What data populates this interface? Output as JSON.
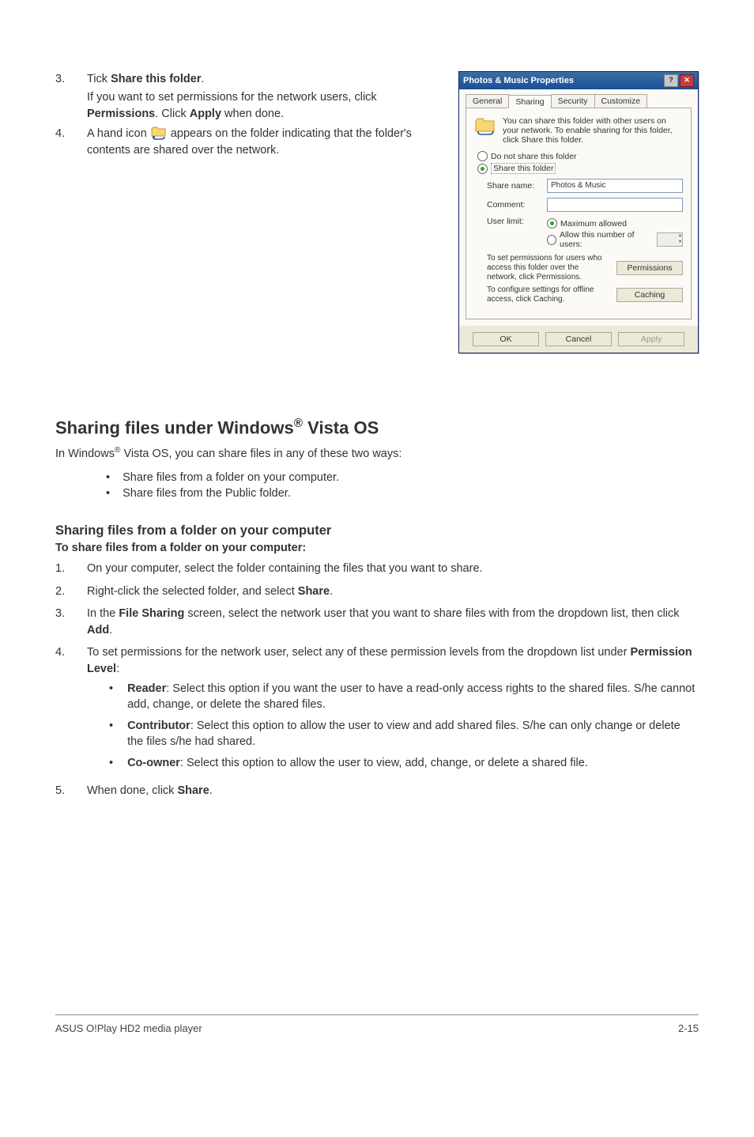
{
  "top": {
    "step3_num": "3.",
    "step3_line1_a": "Tick ",
    "step3_line1_b": "Share this folder",
    "step3_line1_c": ".",
    "step3_sub_a": "If you want to set permissions for the network users, click ",
    "step3_sub_b": "Permissions",
    "step3_sub_c": ". Click ",
    "step3_sub_d": "Apply",
    "step3_sub_e": " when done.",
    "step4_num": "4.",
    "step4_a": "A hand icon ",
    "step4_b": " appears on the folder indicating that the folder's contents are shared over the network."
  },
  "dialog": {
    "title": "Photos & Music Properties",
    "help": "?",
    "close": "✕",
    "tabs": {
      "general": "General",
      "sharing": "Sharing",
      "security": "Security",
      "customize": "Customize"
    },
    "desc": "You can share this folder with other users on your network. To enable sharing for this folder, click Share this folder.",
    "radio_no": "Do not share this folder",
    "radio_yes": "Share this folder",
    "share_name_lbl": "Share name:",
    "share_name_val": "Photos & Music",
    "comment_lbl": "Comment:",
    "userlimit_lbl": "User limit:",
    "ul_max": "Maximum allowed",
    "ul_allow": "Allow this number of users:",
    "perm_txt": "To set permissions for users who access this folder over the network, click Permissions.",
    "perm_btn": "Permissions",
    "cache_txt": "To configure settings for offline access, click Caching.",
    "cache_btn": "Caching",
    "ok": "OK",
    "cancel": "Cancel",
    "apply": "Apply"
  },
  "section_title_a": "Sharing files under Windows",
  "section_title_b": " Vista OS",
  "intro_a": "In Windows",
  "intro_b": " Vista OS, you can share files in any of these two ways:",
  "bullets": {
    "b1": "Share files from a folder on your computer.",
    "b2": "Share files from the Public folder."
  },
  "subh": "Sharing files from a folder on your computer",
  "to_share": "To share files from a folder on your computer:",
  "s": {
    "n1": "1.",
    "t1": "On your computer, select the folder containing the files that you want to share.",
    "n2": "2.",
    "t2a": "Right-click the selected folder, and select ",
    "t2b": "Share",
    "t2c": ".",
    "n3": "3.",
    "t3a": "In the ",
    "t3b": "File Sharing",
    "t3c": " screen, select the network user that you want to share files with from the dropdown list, then click ",
    "t3d": "Add",
    "t3e": ".",
    "n4": "4.",
    "t4a": "To set permissions for the network user, select any of these permission levels from the dropdown list under ",
    "t4b": "Permission Level",
    "t4c": ":",
    "r_label": "Reader",
    "r_txt": ": Select this option if you want the user to have a read-only access rights to the shared files. S/he cannot add, change, or delete the shared files.",
    "c_label": "Contributor",
    "c_txt": ": Select this option to allow the user to view and add shared files. S/he can only change or delete the files s/he had shared.",
    "co_label": "Co-owner",
    "co_txt": ": Select this option to allow the user to view, add, change, or delete a shared file.",
    "n5": "5.",
    "t5a": "When done, click ",
    "t5b": "Share",
    "t5c": "."
  },
  "footer": {
    "left": "ASUS O!Play HD2 media player",
    "right": "2-15"
  }
}
